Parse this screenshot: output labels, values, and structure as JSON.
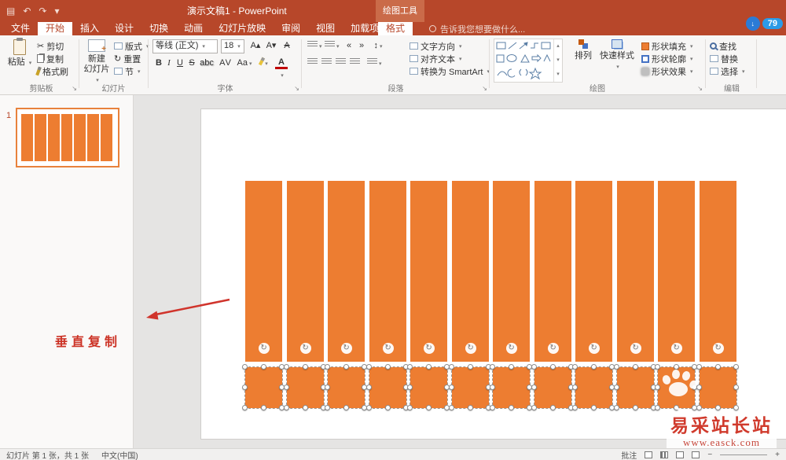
{
  "titlebar": {
    "title": "演示文稿1 - PowerPoint",
    "drawing_tools": "绘图工具"
  },
  "tabs": [
    "文件",
    "开始",
    "插入",
    "设计",
    "切换",
    "动画",
    "幻灯片放映",
    "审阅",
    "视图",
    "加载项"
  ],
  "contextual_tab": "格式",
  "tell_me": "告诉我您想要做什么...",
  "badge_count": "79",
  "icons": {
    "save": "▤",
    "undo": "↶",
    "redo": "↷",
    "more": "▾",
    "cut": "✂",
    "rotate": "↻",
    "down": "↓",
    "grow": "A▴",
    "shrink": "A▾",
    "clear": "A",
    "indent_dec": "«",
    "indent_inc": "»",
    "spacing": "↕"
  },
  "ribbon": {
    "clipboard": {
      "label": "剪贴板",
      "paste": "粘贴",
      "cut": "剪切",
      "copy": "复制",
      "format_painter": "格式刷"
    },
    "slides": {
      "label": "幻灯片",
      "new_slide_1": "新建",
      "new_slide_2": "幻灯片",
      "layout": "版式",
      "reset": "重置",
      "section": "节"
    },
    "font": {
      "label": "字体",
      "name": "等线 (正文)",
      "size": "18",
      "bold": "B",
      "italic": "I",
      "underline": "U",
      "strike": "S",
      "shadow": "abc",
      "spacing": "AV",
      "case_btn": "Aa",
      "color": "A"
    },
    "paragraph": {
      "label": "段落",
      "text_direction": "文字方向",
      "align_text": "对齐文本",
      "smartart": "转换为 SmartArt"
    },
    "drawing": {
      "label": "绘图",
      "arrange": "排列",
      "quick_styles": "快速样式",
      "shape_fill": "形状填充",
      "shape_outline": "形状轮廓",
      "shape_effects": "形状效果"
    },
    "editing": {
      "label": "编辑",
      "find": "查找",
      "replace": "替换",
      "select": "选择"
    }
  },
  "slides_panel": {
    "slide_number": "1"
  },
  "canvas": {
    "bar_count": 12,
    "thumb_bar_count": 7,
    "bar_color": "#ED7D31"
  },
  "annotation": {
    "label": "垂直复制"
  },
  "watermark": {
    "title": "易采站长站",
    "url": "www.easck.com"
  },
  "statusbar": {
    "slide_info": "幻灯片 第 1 张，共 1 张",
    "language": "中文(中国)",
    "comments": "批注"
  }
}
